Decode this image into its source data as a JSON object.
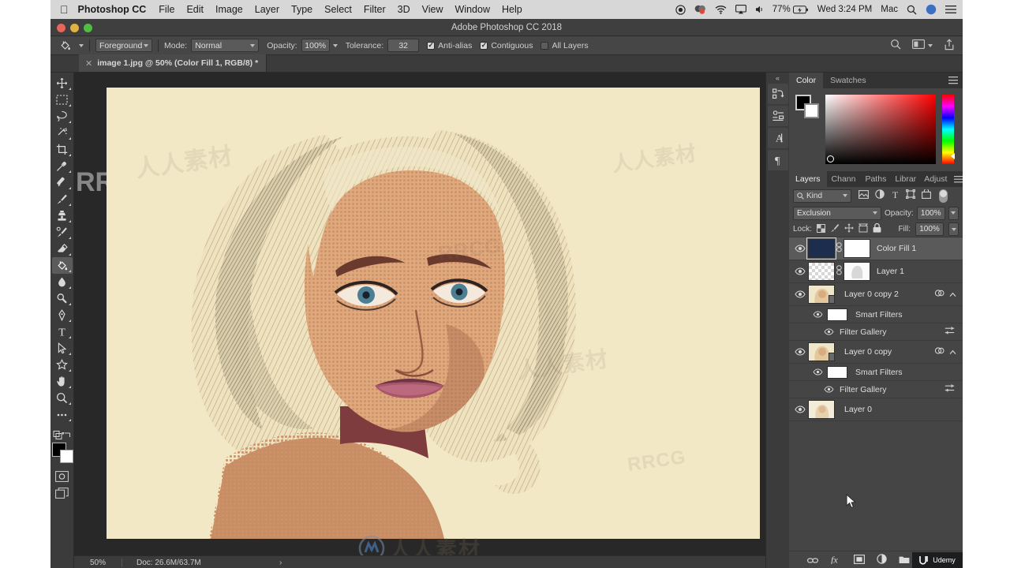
{
  "macbar": {
    "apple_icon": "apple-icon",
    "app_name": "Photoshop CC",
    "menus": [
      "File",
      "Edit",
      "Image",
      "Layer",
      "Type",
      "Select",
      "Filter",
      "3D",
      "View",
      "Window",
      "Help"
    ],
    "status": {
      "battery_percent": "77%",
      "clock": "Wed 3:24 PM",
      "user": "Mac",
      "icons": [
        "record-icon",
        "dropbox-icon",
        "wifi-icon",
        "airplay-icon",
        "volume-icon",
        "battery-icon",
        "search-icon",
        "siri-icon",
        "control-center-icon"
      ]
    }
  },
  "window": {
    "title": "Adobe Photoshop CC 2018"
  },
  "options_bar": {
    "tool_icon": "paint-bucket-icon",
    "fill_source": "Foreground",
    "mode_label": "Mode:",
    "mode_value": "Normal",
    "opacity_label": "Opacity:",
    "opacity_value": "100%",
    "tolerance_label": "Tolerance:",
    "tolerance_value": "32",
    "checkboxes": [
      {
        "label": "Anti-alias",
        "checked": true
      },
      {
        "label": "Contiguous",
        "checked": true
      },
      {
        "label": "All Layers",
        "checked": false
      }
    ],
    "right_icons": [
      "search-icon",
      "workspace-icon",
      "chevron-down-icon",
      "share-icon"
    ]
  },
  "document_tab": {
    "close_icon": "close-icon",
    "title": "image 1.jpg @ 50% (Color Fill 1, RGB/8) *"
  },
  "toolbar": {
    "tools": [
      {
        "name": "move-tool",
        "icon": "move-icon",
        "active": false
      },
      {
        "name": "marquee-tool",
        "icon": "rect-marquee-icon",
        "active": false
      },
      {
        "name": "lasso-tool",
        "icon": "lasso-icon",
        "active": false
      },
      {
        "name": "quick-selection-tool",
        "icon": "magic-wand-icon",
        "active": false
      },
      {
        "name": "crop-tool",
        "icon": "crop-icon",
        "active": false
      },
      {
        "name": "eyedropper-tool",
        "icon": "eyedropper-icon",
        "active": false
      },
      {
        "name": "healing-brush-tool",
        "icon": "healing-brush-icon",
        "active": false
      },
      {
        "name": "brush-tool",
        "icon": "brush-icon",
        "active": false
      },
      {
        "name": "clone-stamp-tool",
        "icon": "clone-stamp-icon",
        "active": false
      },
      {
        "name": "history-brush-tool",
        "icon": "history-brush-icon",
        "active": false
      },
      {
        "name": "eraser-tool",
        "icon": "eraser-icon",
        "active": false
      },
      {
        "name": "paint-bucket-tool",
        "icon": "paint-bucket-icon",
        "active": true
      },
      {
        "name": "blur-tool",
        "icon": "blur-drop-icon",
        "active": false
      },
      {
        "name": "dodge-tool",
        "icon": "dodge-icon",
        "active": false
      },
      {
        "name": "pen-tool",
        "icon": "pen-icon",
        "active": false
      },
      {
        "name": "type-tool",
        "icon": "type-t-icon",
        "active": false
      },
      {
        "name": "path-selection-tool",
        "icon": "path-arrow-icon",
        "active": false
      },
      {
        "name": "custom-shape-tool",
        "icon": "shape-star-icon",
        "active": false
      },
      {
        "name": "hand-tool",
        "icon": "hand-icon",
        "active": false
      },
      {
        "name": "zoom-tool",
        "icon": "magnifier-icon",
        "active": false
      },
      {
        "name": "edit-toolbar",
        "icon": "ellipsis-icon",
        "active": false
      }
    ],
    "quick_mask_icon": "quick-mask-icon",
    "screen_mode_icon": "screen-mode-icon",
    "foreground_color": "#000000",
    "background_color": "#ffffff"
  },
  "canvas": {
    "background_color": "#f3e8c5",
    "artwork_name": "halftone-pop-art-portrait",
    "watermark_text": "人人素材"
  },
  "status_bar": {
    "zoom": "50%",
    "doc_info": "Doc: 26.6M/63.7M",
    "expand_icon": "chevron-right-icon"
  },
  "icon_rail": {
    "collapse_icon": "collapse-chevrons-icon",
    "buttons": [
      "history-panel-icon",
      "properties-panel-icon",
      "character-panel-icon",
      "paragraph-panel-icon"
    ]
  },
  "color_panel": {
    "tabs": [
      {
        "label": "Color",
        "selected": true
      },
      {
        "label": "Swatches",
        "selected": false
      }
    ],
    "menu_icon": "panel-menu-icon",
    "foreground": "#000000",
    "background": "#ffffff"
  },
  "layers_panel": {
    "tabs": [
      {
        "label": "Layers",
        "selected": true
      },
      {
        "label": "Chann",
        "selected": false
      },
      {
        "label": "Paths",
        "selected": false
      },
      {
        "label": "Librar",
        "selected": false
      },
      {
        "label": "Adjust",
        "selected": false
      }
    ],
    "menu_icon": "panel-menu-icon",
    "filter": {
      "search_icon": "search-icon",
      "kind_label": "Kind",
      "chevron_icon": "chevron-down-icon",
      "type_icons": [
        "pixel-layer-icon",
        "adjustment-layer-icon",
        "type-layer-icon",
        "shape-layer-icon",
        "smart-object-icon"
      ],
      "toggle_icon": "filter-toggle-icon"
    },
    "blend_mode": "Exclusion",
    "opacity_label": "Opacity:",
    "opacity_value": "100%",
    "lock_label": "Lock:",
    "lock_icons": [
      "lock-transparent-icon",
      "lock-image-icon",
      "lock-position-icon",
      "lock-artboard-icon",
      "lock-all-icon"
    ],
    "fill_label": "Fill:",
    "fill_value": "100%",
    "layers": [
      {
        "name": "Color Fill 1",
        "visible": true,
        "selected": true,
        "thumb": "solid-navy",
        "has_mask": true,
        "link_icon": "link-icon",
        "type": "layer"
      },
      {
        "name": "Layer 1",
        "visible": true,
        "selected": false,
        "thumb": "transparent-sketch",
        "has_mask": true,
        "link_icon": "link-icon",
        "type": "layer"
      },
      {
        "name": "Layer 0 copy 2",
        "visible": true,
        "selected": false,
        "thumb": "portrait",
        "smart_object": true,
        "right_icons": [
          "smart-filter-icon",
          "chevron-up-icon"
        ],
        "type": "smart-object",
        "children": [
          {
            "name": "Smart Filters",
            "visible": true,
            "type": "smart-filters"
          },
          {
            "name": "Filter Gallery",
            "visible": true,
            "type": "filter",
            "right_icon": "filter-options-icon"
          }
        ]
      },
      {
        "name": "Layer 0 copy",
        "visible": true,
        "selected": false,
        "thumb": "portrait",
        "smart_object": true,
        "right_icons": [
          "smart-filter-icon",
          "chevron-up-icon"
        ],
        "type": "smart-object",
        "children": [
          {
            "name": "Smart Filters",
            "visible": true,
            "type": "smart-filters"
          },
          {
            "name": "Filter Gallery",
            "visible": true,
            "type": "filter",
            "right_icon": "filter-options-icon"
          }
        ]
      },
      {
        "name": "Layer 0",
        "visible": true,
        "selected": false,
        "thumb": "portrait",
        "type": "layer"
      }
    ],
    "footer_buttons": [
      "link-layers-icon",
      "layer-style-fx-icon",
      "add-mask-icon",
      "adjustment-layer-icon",
      "new-group-icon",
      "new-layer-icon",
      "delete-layer-icon"
    ]
  },
  "branding": {
    "udemy_label": "Udemy",
    "udemy_icon": "udemy-logo-icon"
  }
}
